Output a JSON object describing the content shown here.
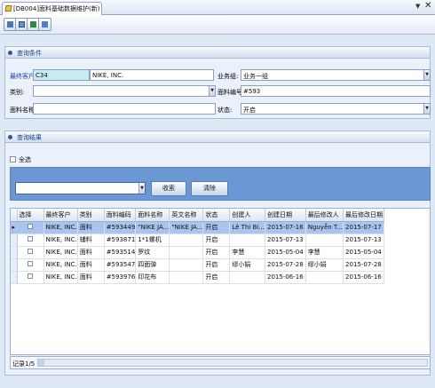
{
  "tab": {
    "title": "[DB004]面料基础数据维护(新)"
  },
  "toolbar": {
    "icons": [
      "pencil-icon",
      "edit-icon",
      "excel-export-icon",
      "exit-icon"
    ]
  },
  "query_panel": {
    "title": "查询条件",
    "customer_label": "最终客户:",
    "customer_code": "C34",
    "customer_name": "NIKE, INC.",
    "business_label": "业务组:",
    "business_value": "业务一组",
    "category_label": "类别:",
    "category_value": "",
    "fabric_code_label": "面料编号:",
    "fabric_code_value": "#593",
    "fabric_name_label": "面料名称:",
    "fabric_name_value": "",
    "status_label": "状态:",
    "status_value": "开启"
  },
  "result_panel": {
    "title": "查询结果",
    "select_all": "全选",
    "search_value": "",
    "search_button": "收索",
    "clear_button": "清除"
  },
  "grid": {
    "columns": [
      "选择",
      "最终客户",
      "类别",
      "面料编码",
      "面料名称",
      "英文名称",
      "状态",
      "创建人",
      "创建日期",
      "最后修改人",
      "最后修改日期"
    ],
    "rows": [
      [
        "",
        "NIKE, INC.",
        "面料",
        "#593449",
        "\"NIKE JA...",
        "\"NIKE JA...",
        "开启",
        "Lê Thi Bi...",
        "2015-07-16",
        "Nguyễn T...",
        "2015-07-17"
      ],
      [
        "",
        "NIKE, INC.",
        "辅料",
        "#593871",
        "1*1螺机",
        "",
        "开启",
        "",
        "2015-07-13",
        "",
        "2015-07-13"
      ],
      [
        "",
        "NIKE, INC.",
        "面料",
        "#593514",
        "罗纹",
        "",
        "开启",
        "李慧",
        "2015-05-04",
        "李慧",
        "2015-05-04"
      ],
      [
        "",
        "NIKE, INC.",
        "面料",
        "#593547",
        "四面弹",
        "",
        "开启",
        "缪小娟",
        "2015-07-28",
        "缪小娟",
        "2015-07-28"
      ],
      [
        "",
        "NIKE, INC.",
        "面料",
        "#593976",
        "印花布",
        "",
        "开启",
        "",
        "2015-06-16",
        "",
        "2015-06-16"
      ]
    ]
  },
  "status": {
    "record": "记录1/5"
  }
}
